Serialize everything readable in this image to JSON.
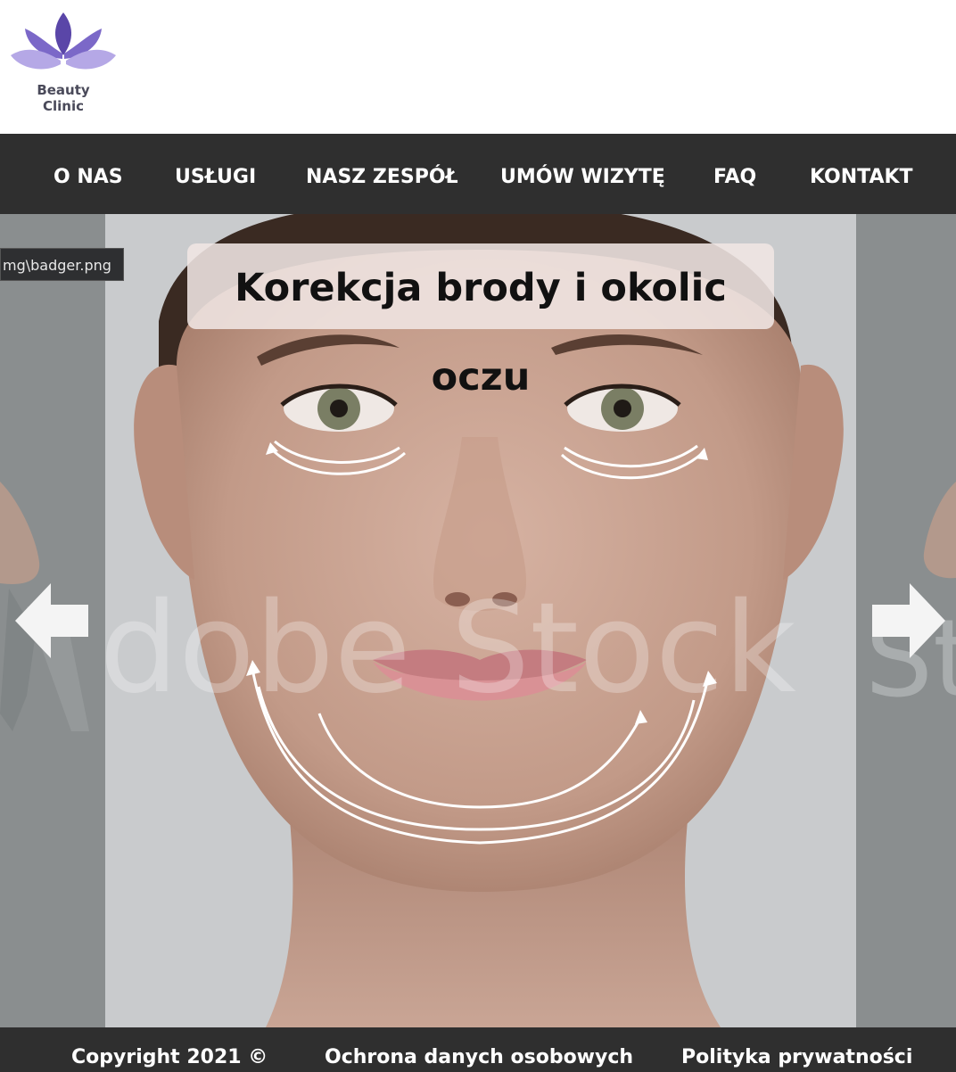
{
  "brand": {
    "name_line1": "Beauty",
    "name_line2": "Clinic",
    "colors": {
      "petal_dark": "#6b55b8",
      "petal_light": "#b7a9e6"
    }
  },
  "nav": {
    "items": [
      {
        "label": "O NAS"
      },
      {
        "label": "USŁUGI"
      },
      {
        "label": "NASZ ZESPÓŁ"
      },
      {
        "label": "UMÓW WIZYTĘ"
      },
      {
        "label": "FAQ"
      },
      {
        "label": "KONTAKT"
      }
    ]
  },
  "slider": {
    "title": "Korekcja brody i okolic oczu",
    "tooltip": "mg\\badger.png",
    "watermark": "Adobe Stock",
    "prev_icon": "arrow-left-icon",
    "next_icon": "arrow-right-icon"
  },
  "footer": {
    "copyright": "Copyright 2021 ©",
    "data_protection": "Ochrona danych osobowych",
    "privacy_policy": "Polityka prywatności"
  },
  "colors": {
    "nav_bg": "#2f2f2f",
    "footer_bg": "#2f2f2f",
    "text_light": "#ffffff"
  }
}
